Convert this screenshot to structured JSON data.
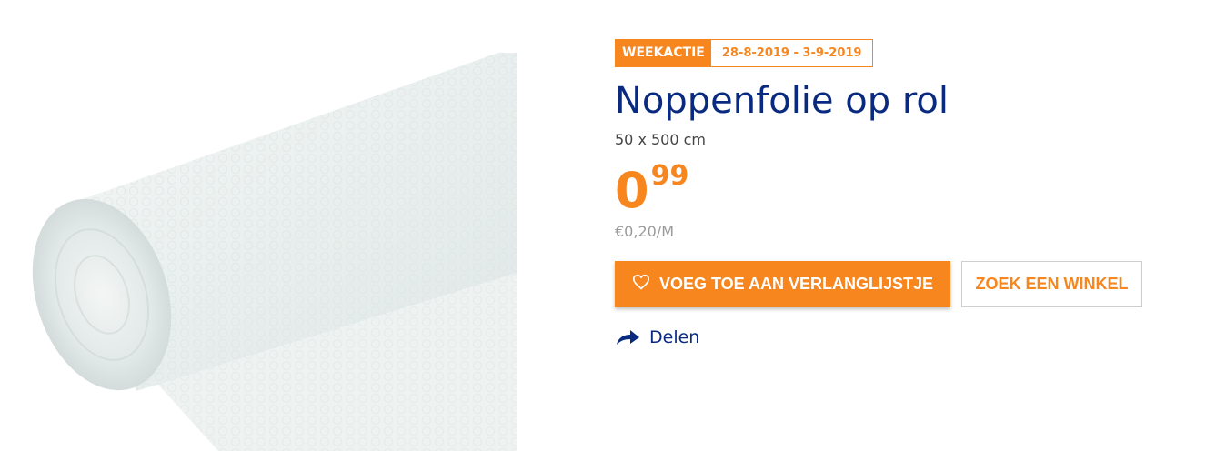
{
  "promo": {
    "label": "WEEKACTIE",
    "dates": "28-8-2019 - 3-9-2019"
  },
  "product": {
    "title": "Noppenfolie op rol",
    "size": "50 x 500 cm",
    "price_main": "0",
    "price_cents": "99",
    "unit_price": "€0,20/M"
  },
  "actions": {
    "wishlist_label": "VOEG TOE AAN VERLANGLIJSTJE",
    "store_label": "ZOEK EEN WINKEL",
    "share_label": "Delen"
  },
  "icons": {
    "wishlist": "heart-icon",
    "share": "share-arrow-icon"
  },
  "colors": {
    "accent": "#f7861e",
    "title": "#0a2a80",
    "muted": "#9b9b9b"
  }
}
